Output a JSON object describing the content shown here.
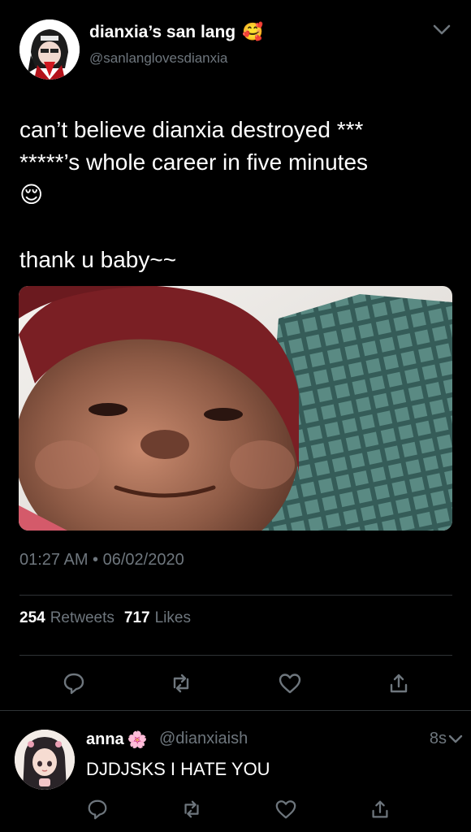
{
  "tweet": {
    "display_name": "dianxia’s san lang",
    "name_emoji": "🥰",
    "handle": "@sanlanglovesdianxia",
    "text_lines": [
      "can’t believe dianxia destroyed ***",
      "*****’s whole career in five minutes",
      "😌",
      "thank u baby~~"
    ],
    "timestamp": "01:27 AM • 06/02/2020",
    "retweets_count": "254",
    "retweets_label": "Retweets",
    "likes_count": "717",
    "likes_label": "Likes"
  },
  "reply": {
    "name": "anna",
    "name_emoji": "🌸",
    "handle": "@dianxiaish",
    "time": "8s",
    "text": "DJDJSKS I HATE YOU"
  },
  "icons": {
    "actions": [
      "reply-icon",
      "retweet-icon",
      "like-icon",
      "share-icon"
    ],
    "menu": "chevron-down-icon"
  },
  "colors": {
    "background": "#000000",
    "text": "#ffffff",
    "secondary": "#6e767d",
    "divider": "#2f3336"
  }
}
